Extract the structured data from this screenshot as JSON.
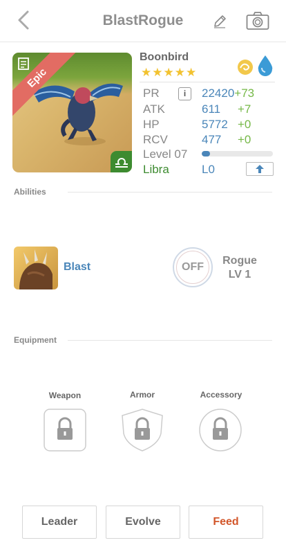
{
  "header": {
    "title": "BlastRogue"
  },
  "monster": {
    "rarity": "Epic",
    "name": "Boonbird",
    "stars": "★★★★★",
    "stats": [
      {
        "label": "PR",
        "value": "22420",
        "bonus": "+73"
      },
      {
        "label": "ATK",
        "value": "611",
        "bonus": "+7"
      },
      {
        "label": "HP",
        "value": "5772",
        "bonus": "+0"
      },
      {
        "label": "RCV",
        "value": "477",
        "bonus": "+0"
      }
    ],
    "info_label": "i",
    "level_label": "Level 07",
    "level_progress": 0.12,
    "sign": "Libra",
    "sign_level": "L0"
  },
  "abilities": {
    "heading": "Abilities",
    "ability_name": "Blast",
    "toggle_label": "OFF",
    "class_name": "Rogue",
    "class_level": "LV 1"
  },
  "equipment": {
    "heading": "Equipment",
    "slots": [
      {
        "label": "Weapon"
      },
      {
        "label": "Armor"
      },
      {
        "label": "Accessory"
      }
    ]
  },
  "actions": {
    "leader": "Leader",
    "evolve": "Evolve",
    "feed": "Feed",
    "feed_color": "#d2562a"
  },
  "icons": {
    "back": "chevron-left-icon",
    "edit": "pencil-icon",
    "camera": "camera-icon",
    "lock": "lock-icon",
    "upgrade": "arrow-up-icon"
  }
}
